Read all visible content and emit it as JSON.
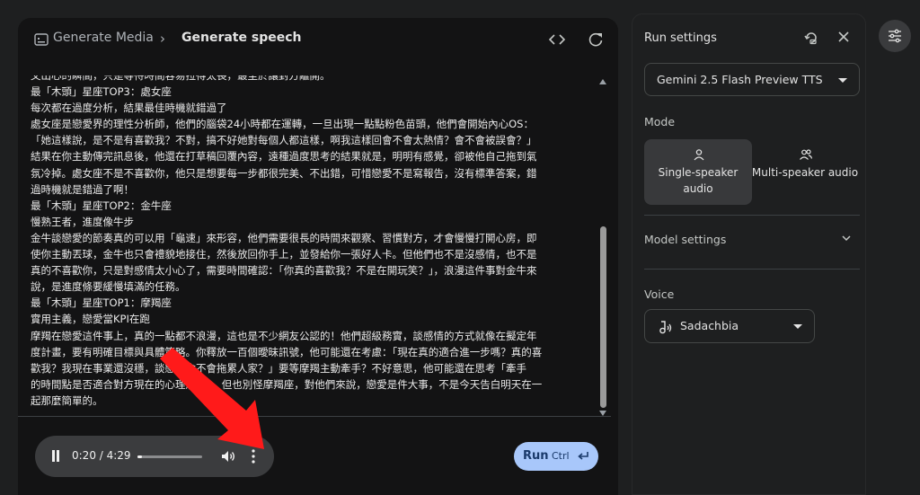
{
  "header": {
    "breadcrumb_parent": "Generate Media",
    "breadcrumb_separator": "›",
    "title": "Generate speech",
    "icons": [
      "media-icon",
      "code-icon",
      "refresh-icon"
    ]
  },
  "editor": {
    "lines": [
      "文出心的瞬間，只是等待時間容易拉得太長，最至於讓對方離開。",
      "最「木頭」星座TOP3：處女座",
      "每次都在過度分析，結果最佳時機就錯過了",
      "處女座是戀愛界的理性分析師，他們的腦袋24小時都在運轉，一旦出現一點點粉色苗頭，他們會開始內心OS：",
      "「她這樣說，是不是有喜歡我？不對，搞不好她對每個人都這樣，啊我這樣回會不會太熱情？會不會被誤會？」",
      "結果在你主動傳完訊息後，他還在打草稿回覆內容，遠種過度思考的結果就是，明明有感覺，卻被他自己拖到氣",
      "氛冷掉。處女座不是不喜歡你，他只是想要每一步都很完美、不出錯，可惜戀愛不是寫報告，沒有標準答案，錯",
      "過時機就是錯過了啊！",
      "最「木頭」星座TOP2：金牛座",
      "慢熟王者，進度像牛步",
      "金牛談戀愛的節奏真的可以用「龜速」來形容，他們需要很長的時間來觀察、習慣對方，才會慢慢打開心房，即",
      "使你主動丟球，金牛也只會禮貌地接住，然後放回你手上，並發給你一張好人卡。但他們也不是沒感情，也不是",
      "真的不喜歡你，只是對感情太小心了，需要時間確認：「你真的喜歡我？不是在開玩笑？」，浪漫這件事對金牛來",
      "說，是進度條要緩慢填滿的任務。",
      "最「木頭」星座TOP1：摩羯座",
      "實用主義，戀愛當KPI在跑",
      "摩羯在戀愛這件事上，真的一點都不浪漫，這也是不少網友公認的！他們超級務實，談感情的方式就像在擬定年",
      "度計畫，要有明確目標與具體策略。你釋放一百個曖昧訊號，他可能還在考慮：「現在真的適合進一步嗎？真的喜",
      "歡我？我現在事業還沒穩，談戀愛會不會拖累人家？」要等摩羯主動牽手？不好意思，他可能還在思考「牽手",
      "的時間點是否適合對方現在的心理狀態」。但也別怪摩羯座，對他們來說，戀愛是件大事，不是今天告白明天在一",
      "起那麼簡單的。"
    ]
  },
  "player": {
    "time": "0:20 / 4:29",
    "progress": 0.074
  },
  "run_button": {
    "label": "Run",
    "shortcut": "Ctrl"
  },
  "settings": {
    "title": "Run settings",
    "model": "Gemini 2.5 Flash Preview TTS",
    "mode_label": "Mode",
    "mode_single": "Single-speaker audio",
    "mode_multi": "Multi-speaker audio",
    "selected_mode": "single",
    "model_settings_label": "Model settings",
    "voice_label": "Voice",
    "voice": "Sadachbia"
  },
  "colors": {
    "background": "#1e1f20",
    "panel": "#131314",
    "run_button": "#a8c7fa",
    "annotation_arrow": "#ff1a1a"
  }
}
